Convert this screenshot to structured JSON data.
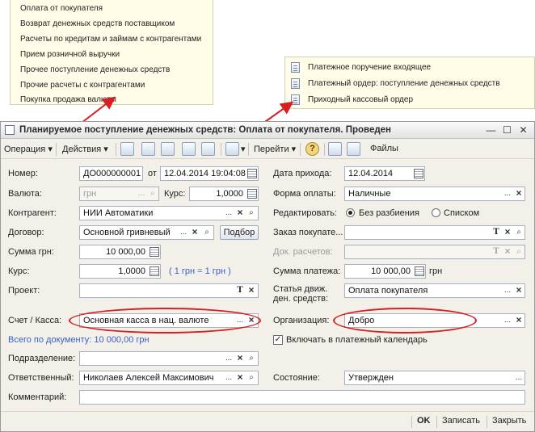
{
  "operation_menu": {
    "items": [
      "Оплата от покупателя",
      "Возврат денежных средств поставщиком",
      "Расчеты по кредитам и займам с контрагентами",
      "Прием розничной выручки",
      "Прочее поступление денежных средств",
      "Прочие расчеты с контрагентами",
      "Покупка продажа валюты"
    ]
  },
  "document_menu": {
    "items": [
      "Платежное поручение входящее",
      "Платежный ордер: поступление денежных средств",
      "Приходный кассовый ордер"
    ]
  },
  "window": {
    "title": "Планируемое поступление денежных средств: Оплата от покупателя. Проведен",
    "buttons": {
      "minimize": "—",
      "maximize": "☐",
      "close": "✕"
    }
  },
  "toolbar": {
    "operation": "Операция",
    "actions": "Действия",
    "goto": "Перейти",
    "files": "Файлы"
  },
  "form": {
    "number_label": "Номер:",
    "number": "ДО000000001",
    "from_label": "от",
    "date": "12.04.2014 19:04:08",
    "receipt_date_label": "Дата прихода:",
    "receipt_date": "12.04.2014",
    "currency_label": "Валюта:",
    "currency": "грн",
    "rate_label": "Курс:",
    "rate": "1,0000",
    "payment_form_label": "Форма оплаты:",
    "payment_form": "Наличные",
    "counterparty_label": "Контрагент:",
    "counterparty": "НИИ Автоматики",
    "edit_label": "Редактировать:",
    "no_split_label": "Без разбиения",
    "list_label": "Списком",
    "contract_label": "Договор:",
    "contract": "Основной гривневый",
    "select_button": "Подбор",
    "buyer_order_label": "Заказ покупате...",
    "buyer_order": "",
    "amount_uah_label": "Сумма грн:",
    "amount_uah": "10 000,00",
    "settlement_doc_label": "Док. расчетов:",
    "settlement_doc": "",
    "rate2_label": "Курс:",
    "rate2": "1,0000",
    "rate_note": "( 1 грн = 1 грн )",
    "payment_amount_label": "Сумма платежа:",
    "payment_amount": "10 000,00",
    "payment_currency": "грн",
    "project_label": "Проект:",
    "project": "",
    "cash_flow_item_label_1": "Статья движ.",
    "cash_flow_item_label_2": "ден. средств:",
    "cash_flow_item": "Оплата покупателя",
    "account_label": "Счет / Касса:",
    "account": "Основная касса в нац. валюте",
    "organization_label": "Организация:",
    "organization": "Добро",
    "total_text": "Всего по документу: 10 000,00 грн",
    "include_calendar_label": "Включать в платежный календарь",
    "include_calendar_checked": true,
    "department_label": "Подразделение:",
    "department": "",
    "responsible_label": "Ответственный:",
    "responsible": "Николаев Алексей Максимович",
    "status_label": "Состояние:",
    "status": "Утвержден",
    "comment_label": "Комментарий:",
    "comment": ""
  },
  "footer": {
    "ok": "OK",
    "write": "Записать",
    "close": "Закрыть"
  },
  "accent_colors": {
    "annotation_red": "#d42020",
    "link_blue": "#3a62c4"
  }
}
